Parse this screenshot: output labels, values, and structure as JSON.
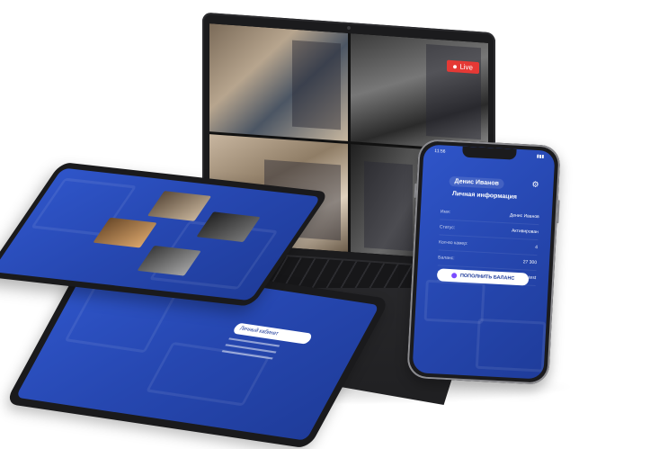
{
  "laptop": {
    "live_badge": "Live"
  },
  "tablet_bottom": {
    "menu_button": "Личный кабинет"
  },
  "phone": {
    "time": "11:56",
    "user_name": "Денис Иванов",
    "section_title": "Личная информация",
    "rows": [
      {
        "key": "Имя:",
        "value": "Денис Иванов"
      },
      {
        "key": "Статус:",
        "value": "Активирован"
      },
      {
        "key": "Кол-во камер:",
        "value": "4"
      },
      {
        "key": "Баланс:",
        "value": "27 300"
      },
      {
        "key": "Логин:",
        "value": "test"
      },
      {
        "key": "E-mail:",
        "value": "denis@yandex.ru"
      }
    ],
    "topup_button": "ПОПОЛНИТЬ БАЛАНС"
  },
  "icons": {
    "settings": "gear-icon",
    "live": "live-dot-icon",
    "wallet": "wallet-icon"
  },
  "colors": {
    "app_blue": "#2647b0",
    "live_red": "#e53935",
    "device_dark": "#1b1b1d"
  }
}
